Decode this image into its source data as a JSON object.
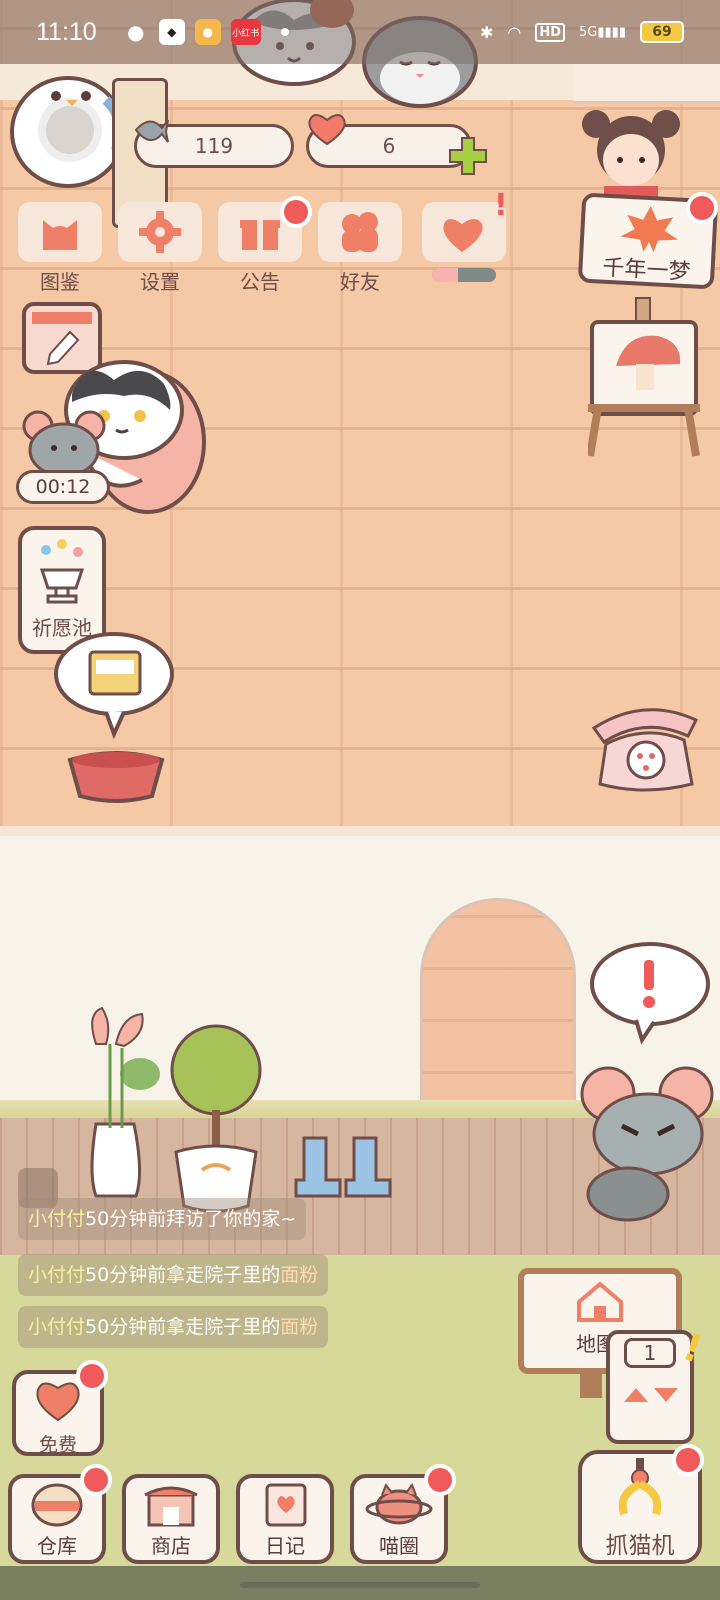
{
  "status_bar": {
    "time": "11:10",
    "app_icons": [
      "wechat-icon",
      "qq-icon",
      "weibo-icon",
      "xiaohongshu-icon"
    ],
    "xhs_text": "小红书",
    "hd": "HD",
    "signal": "5G",
    "battery": "69"
  },
  "currency": {
    "fish": "119",
    "hearts": "6"
  },
  "menu": [
    {
      "label": "图鉴",
      "icon": "cat-face-icon",
      "badge": false
    },
    {
      "label": "设置",
      "icon": "gear-icon",
      "badge": false
    },
    {
      "label": "公告",
      "icon": "gift-icon",
      "badge": true
    },
    {
      "label": "好友",
      "icon": "friends-icon",
      "badge": false
    },
    {
      "label": "",
      "icon": "heart-icon",
      "badge": true,
      "progress": 0.4
    }
  ],
  "event_banner": {
    "label": "千年一梦"
  },
  "timer": "00:12",
  "wishing_pool": "祈愿池",
  "messages": [
    {
      "name": "小付付",
      "text": "50分钟前拜访了你的家~",
      "item": ""
    },
    {
      "name": "小付付",
      "text": "50分钟前拿走院子里的",
      "item": "面粉"
    },
    {
      "name": "小付付",
      "text": "50分钟前拿走院子里的",
      "item": "面粉"
    }
  ],
  "free_button": "免费",
  "map_button": "地图",
  "counter": "1",
  "nav": [
    {
      "label": "仓库",
      "icon": "warehouse-icon",
      "badge": true
    },
    {
      "label": "商店",
      "icon": "shop-icon",
      "badge": false
    },
    {
      "label": "日记",
      "icon": "diary-icon",
      "badge": false
    },
    {
      "label": "喵圈",
      "icon": "cat-planet-icon",
      "badge": true
    }
  ],
  "claw_machine": "抓猫机",
  "colors": {
    "outline": "#6f4d48",
    "accent_red": "#f05a5a",
    "menu_icon": "#ef7f67",
    "wall": "#f5c8a6",
    "yard": "#d7d99a"
  }
}
